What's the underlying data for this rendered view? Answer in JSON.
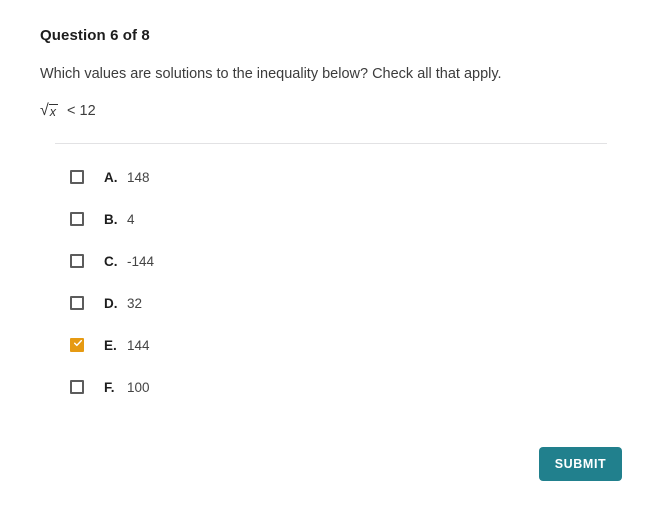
{
  "question": {
    "heading": "Question 6 of 8",
    "prompt": "Which values are solutions to the inequality below? Check all that apply.",
    "expression": {
      "radical_sign": "√",
      "radicand": "x",
      "relation": "< 12"
    }
  },
  "options": [
    {
      "letter": "A.",
      "value": "148",
      "checked": false
    },
    {
      "letter": "B.",
      "value": "4",
      "checked": false
    },
    {
      "letter": "C.",
      "value": "-144",
      "checked": false
    },
    {
      "letter": "D.",
      "value": "32",
      "checked": false
    },
    {
      "letter": "E.",
      "value": "144",
      "checked": true
    },
    {
      "letter": "F.",
      "value": "100",
      "checked": false
    }
  ],
  "actions": {
    "submit_label": "SUBMIT"
  },
  "colors": {
    "submit_background": "#21808d",
    "checked_checkbox": "#e69a12",
    "checkbox_border": "#5c5c5c",
    "divider": "#e2e2e4",
    "heading_text": "#1d1d1d",
    "body_text": "#3c3c3c"
  }
}
